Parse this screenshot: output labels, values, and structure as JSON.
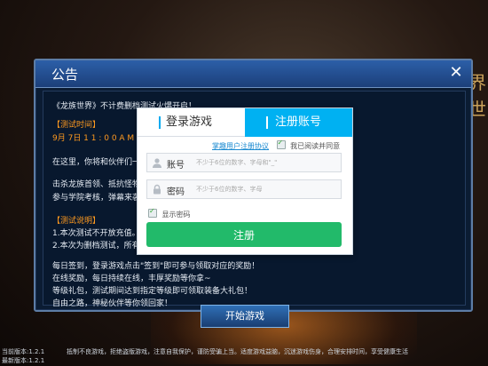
{
  "notice": {
    "title": "公告",
    "close_icon": "close-icon",
    "lines": [
      "《龙族世界》不计费删档测试火爆开启！",
      "【测试时间】",
      "9月 7日 1 1 : 0 0 A M —9月",
      "在这里，你将和伙伴们一起",
      "击杀龙族首领、抵抗怪物入",
      "参与学院考核，弹幕来袭，",
      "【测试说明】",
      "1.本次测试不开放充值。",
      "2.本次为删档测试，所有游",
      "每日签到，登录游戏点击\"签到\"即可参与领取对应的奖励！",
      "在线奖励，每日持续在线，丰厚奖励等你拿~",
      "等级礼包，测试期间达到指定等级即可领取装备大礼包！",
      "自由之路，神秘伙伴等你领回家！"
    ]
  },
  "register": {
    "tab_login": "登录游戏",
    "tab_register": "注册账号",
    "agreement_link": "掌趣用户注册协议",
    "agreement_text": "我已阅读并同意",
    "account_label": "账号",
    "account_placeholder": "不少于6位的数字、字母和\"_\"",
    "password_label": "密码",
    "password_placeholder": "不少于6位的数字、字母",
    "show_password": "显示密码",
    "submit": "注册",
    "colors": {
      "tab_active": "#00b1f2",
      "submit": "#22ba6a"
    }
  },
  "start_button": "开始游戏",
  "versions": {
    "current": "当前版本:1.2.1",
    "latest": "最新版本:1.2.1"
  },
  "advisory": "抵制不良游戏，拒绝盗版游戏，注意自我保护，谨防受骗上当。适度游戏益脑，沉迷游戏伤身，合理安排时间，享受健康生活"
}
